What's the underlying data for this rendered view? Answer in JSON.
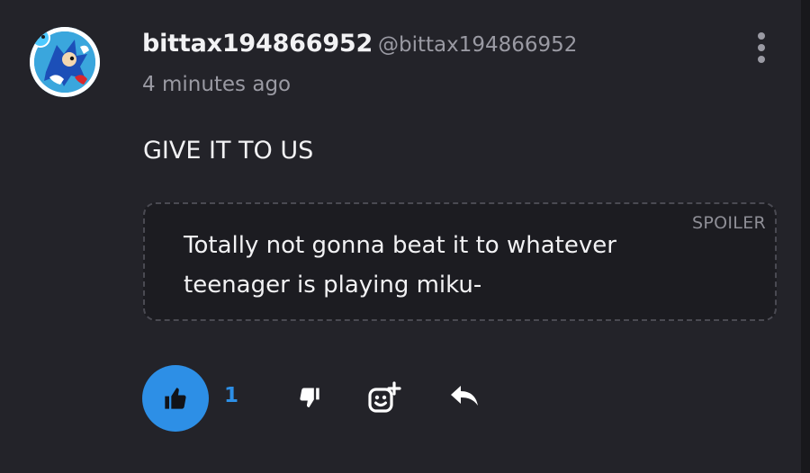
{
  "comment": {
    "username": "bittax194866952",
    "handle": "@bittax194866952",
    "timestamp": "4 minutes ago",
    "text": "GIVE IT TO US",
    "spoiler": {
      "label": "SPOILER",
      "text": "Totally not gonna beat it to whatever teenager is playing miku-"
    }
  },
  "actions": {
    "like_count": "1",
    "icons": [
      "thumbs-up-icon",
      "thumbs-down-icon",
      "add-reaction-icon",
      "reply-icon",
      "more-options-icon"
    ]
  },
  "colors": {
    "background": "#232329",
    "accent": "#2d8fe6",
    "text": "#f2f2f4",
    "muted": "#9a9aa3"
  }
}
